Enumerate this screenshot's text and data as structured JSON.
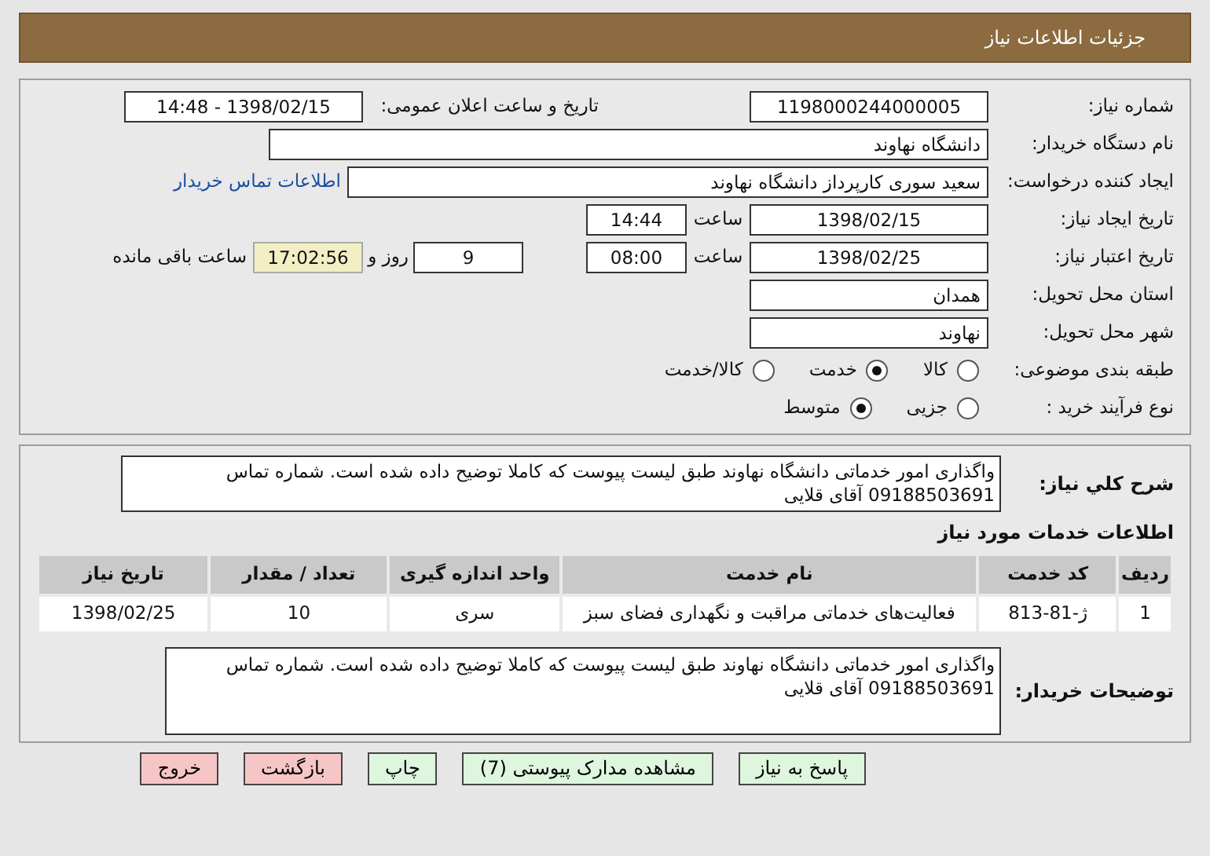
{
  "header": {
    "title": "جزئیات اطلاعات نیاز"
  },
  "details": {
    "need_number": {
      "label": "شماره نیاز:",
      "value": "1198000244000005"
    },
    "announce": {
      "label": "تاریخ و ساعت اعلان عمومی:",
      "value": "1398/02/15 - 14:48"
    },
    "buyer": {
      "label": "نام دستگاه خریدار:",
      "value": "دانشگاه نهاوند"
    },
    "creator": {
      "label": "ایجاد کننده درخواست:",
      "value": "سعید سوری کارپرداز دانشگاه نهاوند",
      "link": "اطلاعات تماس خریدار"
    },
    "created": {
      "label": "تاریخ ایجاد نیاز:",
      "date": "1398/02/15",
      "time_label": "ساعت",
      "time": "14:44"
    },
    "validity": {
      "label": "تاریخ اعتبار نیاز:",
      "date": "1398/02/25",
      "time_label": "ساعت",
      "time": "08:00",
      "days": "9",
      "days_label": "روز و",
      "remaining": "17:02:56",
      "remaining_label": "ساعت باقی مانده"
    },
    "province": {
      "label": "استان محل تحویل:",
      "value": "همدان"
    },
    "city": {
      "label": "شهر محل تحویل:",
      "value": "نهاوند"
    },
    "category": {
      "label": "طبقه بندی موضوعی:",
      "options": [
        {
          "label": "کالا",
          "selected": false
        },
        {
          "label": "خدمت",
          "selected": true
        },
        {
          "label": "کالا/خدمت",
          "selected": false
        }
      ]
    },
    "process": {
      "label": "نوع فرآیند خرید :",
      "options": [
        {
          "label": "جزیی",
          "selected": false
        },
        {
          "label": "متوسط",
          "selected": true
        }
      ]
    }
  },
  "summary": {
    "label": "شرح کلي نیاز:",
    "value": "واگذاری امور خدماتی دانشگاه نهاوند طبق لیست پیوست که کاملا توضیح داده شده است. شماره تماس 09188503691 آقای قلایی"
  },
  "services": {
    "title": "اطلاعات خدمات مورد نیاز",
    "columns": [
      "ردیف",
      "کد خدمت",
      "نام خدمت",
      "واحد اندازه گیری",
      "تعداد / مقدار",
      "تاریخ نیاز"
    ],
    "rows": [
      [
        "1",
        "ژ-81-813",
        "فعالیت‌های خدماتی مراقبت و نگهداری فضای سبز",
        "سری",
        "10",
        "1398/02/25"
      ]
    ]
  },
  "buyer_notes": {
    "label": "توضیحات خریدار:",
    "value": "واگذاری امور خدماتی دانشگاه نهاوند طبق لیست پیوست که کاملا توضیح داده شده است. شماره تماس 09188503691 آقای قلایی"
  },
  "buttons": [
    {
      "label": "پاسخ به نیاز",
      "kind": "action"
    },
    {
      "label": "مشاهده مدارک پیوستی (7)",
      "kind": "action"
    },
    {
      "label": "چاپ",
      "kind": "action"
    },
    {
      "label": "بازگشت",
      "kind": "exit"
    },
    {
      "label": "خروج",
      "kind": "exit"
    }
  ]
}
